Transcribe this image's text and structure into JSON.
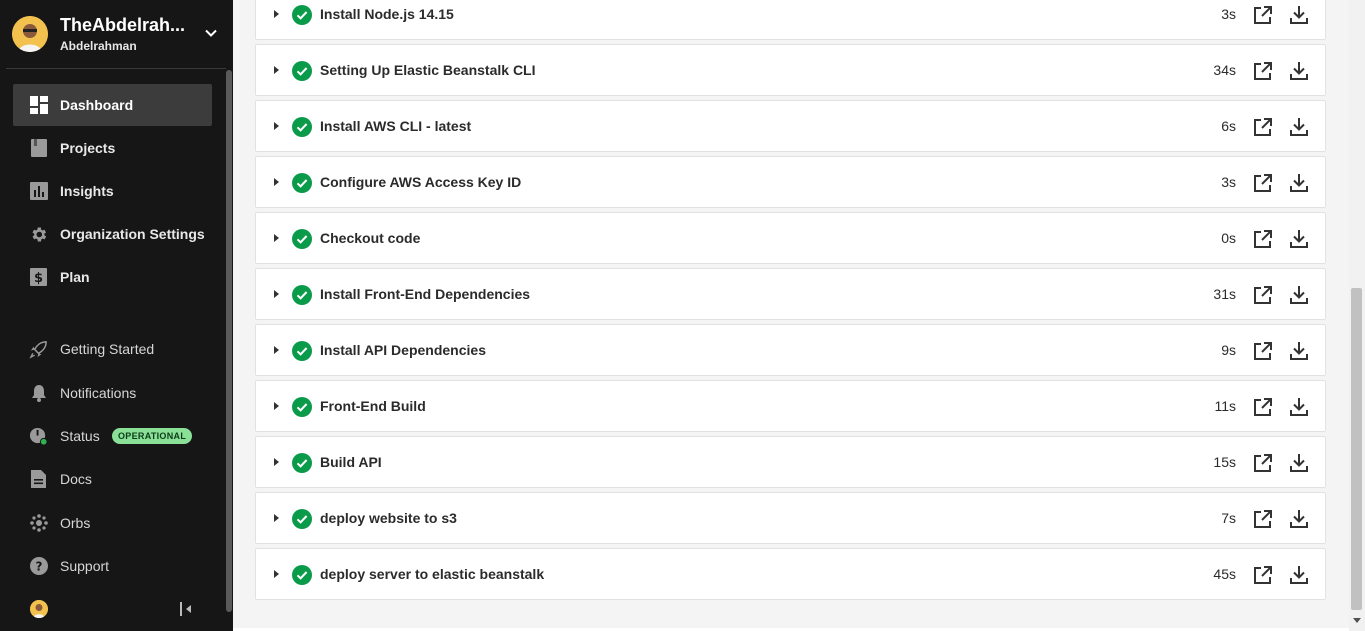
{
  "sidebar": {
    "org_name": "TheAbdelrah...",
    "org_user": "Abdelrahman",
    "nav": [
      {
        "label": "Dashboard",
        "icon": "dashboard-icon"
      },
      {
        "label": "Projects",
        "icon": "projects-icon"
      },
      {
        "label": "Insights",
        "icon": "insights-icon"
      },
      {
        "label": "Organization Settings",
        "icon": "gear-icon"
      },
      {
        "label": "Plan",
        "icon": "dollar-icon"
      }
    ],
    "secondary": [
      {
        "label": "Getting Started",
        "icon": "rocket-icon"
      },
      {
        "label": "Notifications",
        "icon": "bell-icon"
      },
      {
        "label": "Status",
        "icon": "status-icon"
      },
      {
        "label": "Docs",
        "icon": "docs-icon"
      },
      {
        "label": "Orbs",
        "icon": "orbs-icon"
      },
      {
        "label": "Support",
        "icon": "help-icon"
      }
    ],
    "status_badge": "OPERATIONAL"
  },
  "steps": [
    {
      "title": "Install Node.js 14.15",
      "duration": "3s"
    },
    {
      "title": "Setting Up Elastic Beanstalk CLI",
      "duration": "34s"
    },
    {
      "title": "Install AWS CLI - latest",
      "duration": "6s"
    },
    {
      "title": "Configure AWS Access Key ID",
      "duration": "3s"
    },
    {
      "title": "Checkout code",
      "duration": "0s"
    },
    {
      "title": "Install Front-End Dependencies",
      "duration": "31s"
    },
    {
      "title": "Install API Dependencies",
      "duration": "9s"
    },
    {
      "title": "Front-End Build",
      "duration": "11s"
    },
    {
      "title": "Build API",
      "duration": "15s"
    },
    {
      "title": "deploy website to s3",
      "duration": "7s"
    },
    {
      "title": "deploy server to elastic beanstalk",
      "duration": "45s"
    }
  ],
  "colors": {
    "success": "#0a9b4a",
    "sidebar_bg": "#161616",
    "active_bg": "#3c3c3c",
    "badge_bg": "#8ae097"
  }
}
